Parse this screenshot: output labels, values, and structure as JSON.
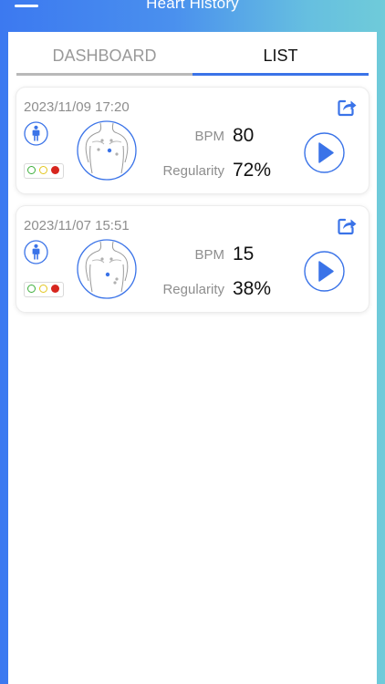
{
  "header": {
    "title": "Heart History",
    "menu_icon": "hamburger-menu-icon"
  },
  "tabs": [
    {
      "label": "DASHBOARD",
      "active": false
    },
    {
      "label": "LIST",
      "active": true
    }
  ],
  "records": [
    {
      "datetime": "2023/11/09 17:20",
      "bpm_label": "BPM",
      "bpm": "80",
      "regularity_label": "Regularity",
      "regularity": "72%",
      "signal_lights": [
        "empty-green",
        "empty-yellow",
        "filled-red"
      ]
    },
    {
      "datetime": "2023/11/07 15:51",
      "bpm_label": "BPM",
      "bpm": "15",
      "regularity_label": "Regularity",
      "regularity": "38%",
      "signal_lights": [
        "empty-green",
        "empty-yellow",
        "filled-red"
      ]
    }
  ],
  "colors": {
    "accent": "#3a73e8",
    "gradient_start": "#3c79f0",
    "gradient_end": "#6fcbd9",
    "label_gray": "#8e8e8e",
    "light_green": "#3cae3a",
    "light_yellow": "#e3c61d",
    "light_red": "#d7261e"
  },
  "icons": {
    "share": "share-icon",
    "person": "person-icon",
    "torso": "torso-electrode-icon",
    "play": "play-icon"
  }
}
